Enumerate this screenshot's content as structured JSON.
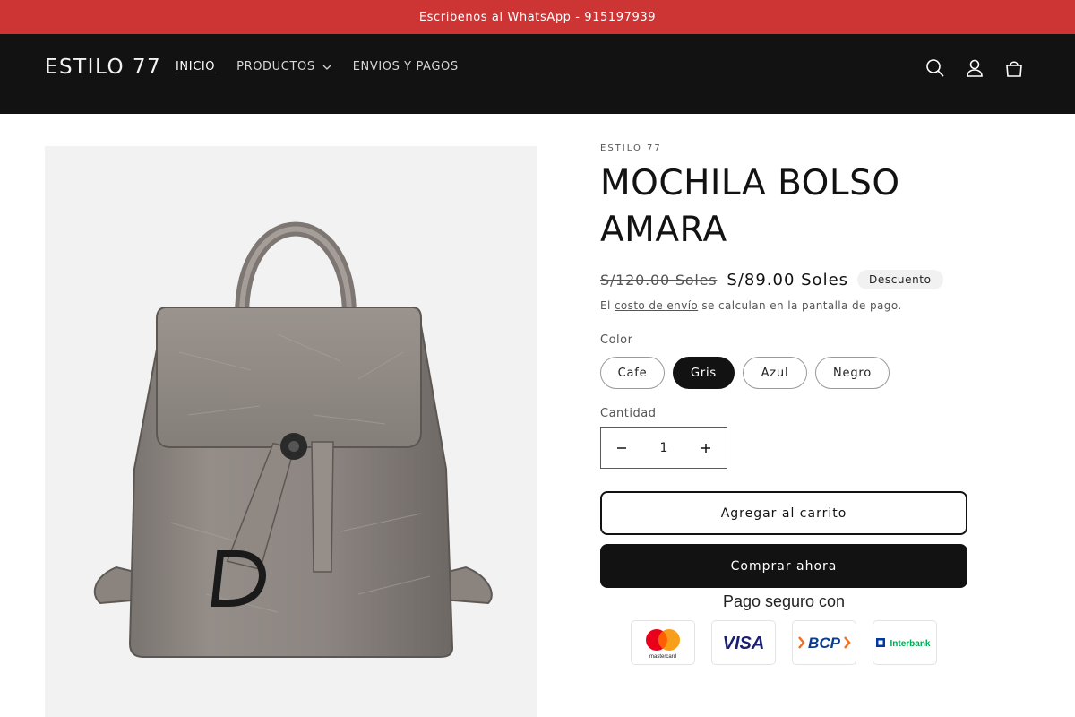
{
  "announcement": {
    "text": "Escribenos al WhatsApp - 915197939"
  },
  "header": {
    "logo": "ESTILO 77",
    "nav": [
      {
        "label": "INICIO",
        "active": true
      },
      {
        "label": "PRODUCTOS",
        "has_dropdown": true
      },
      {
        "label": "ENVIOS Y PAGOS"
      }
    ],
    "icons": [
      "search-icon",
      "account-icon",
      "cart-icon"
    ]
  },
  "product": {
    "vendor": "ESTILO 77",
    "title": "MOCHILA BOLSO AMARA",
    "price_regular": "S/120.00 Soles",
    "price_sale": "S/89.00 Soles",
    "badge": "Descuento",
    "shipping": {
      "prefix": "El",
      "link": "costo de envío",
      "suffix": "se calculan en la pantalla de pago."
    },
    "color": {
      "label": "Color",
      "options": [
        "Cafe",
        "Gris",
        "Azul",
        "Negro"
      ],
      "selected": "Gris"
    },
    "quantity": {
      "label": "Cantidad",
      "value": "1"
    },
    "add_to_cart": "Agregar al carrito",
    "buy_now": "Comprar ahora",
    "secure_payment": "Pago seguro con",
    "payment_methods": [
      "mastercard",
      "VISA",
      "BCP",
      "Interbank"
    ]
  },
  "colors": {
    "announcement_bg": "#cd3535",
    "header_bg": "#121212",
    "accent": "#121212"
  }
}
